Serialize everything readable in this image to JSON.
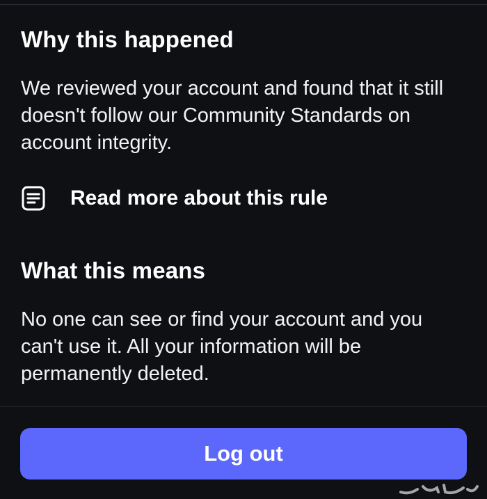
{
  "why_section": {
    "heading": "Why this happened",
    "body": "We reviewed your account and found that it still doesn't follow our Community Standards on account integrity.",
    "rule_link_label": "Read more about this rule",
    "rule_link_icon": "document-icon"
  },
  "means_section": {
    "heading": "What this means",
    "body": "No one can see or find your account and you can't use it. All your information will be permanently deleted."
  },
  "logout": {
    "label": "Log out",
    "color": "#5b68fb"
  },
  "watermark": {
    "icon": "watermark-logo"
  },
  "colors": {
    "background": "#0f1014",
    "divider": "#2a2c33",
    "text": "#ffffff"
  }
}
